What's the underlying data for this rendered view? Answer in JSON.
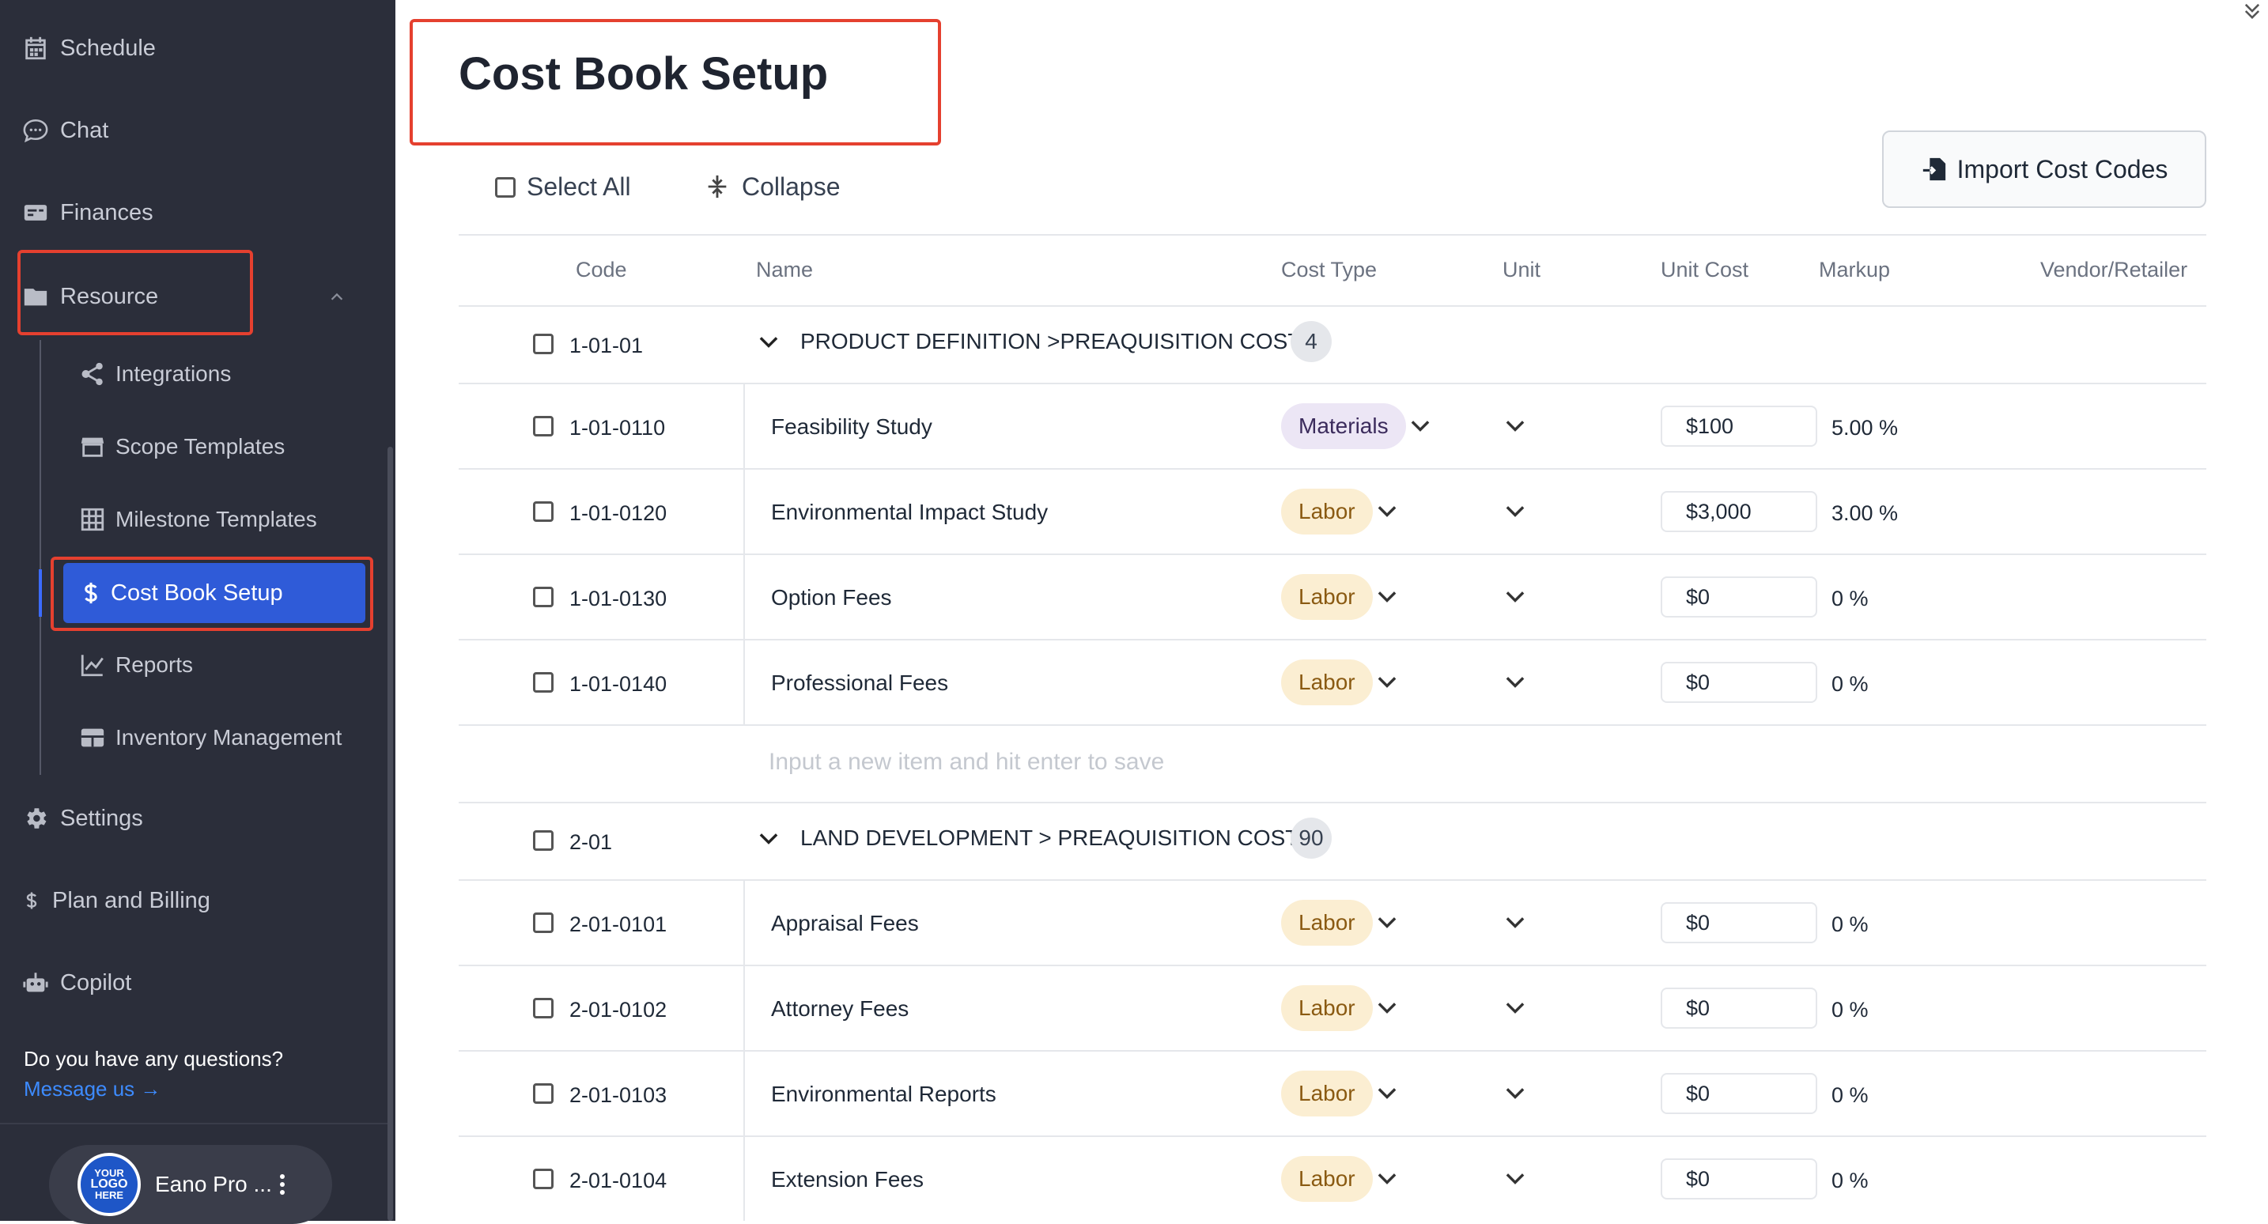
{
  "sidebar": {
    "nav": [
      {
        "label": "Schedule",
        "icon": "calendar-icon"
      },
      {
        "label": "Chat",
        "icon": "chat-icon"
      },
      {
        "label": "Finances",
        "icon": "finances-icon"
      },
      {
        "label": "Resource",
        "icon": "folder-icon"
      }
    ],
    "resource_children": [
      {
        "label": "Integrations",
        "icon": "share-icon"
      },
      {
        "label": "Scope Templates",
        "icon": "store-icon"
      },
      {
        "label": "Milestone Templates",
        "icon": "grid-icon"
      },
      {
        "label": "Cost Book Setup",
        "icon": "dollar-icon",
        "active": true
      },
      {
        "label": "Reports",
        "icon": "chart-line-icon"
      },
      {
        "label": "Inventory Management",
        "icon": "table-icon"
      }
    ],
    "bottom_nav": [
      {
        "label": "Settings",
        "icon": "gear-icon"
      },
      {
        "label": "Plan and Billing",
        "icon": "dollar-icon"
      },
      {
        "label": "Copilot",
        "icon": "robot-icon"
      }
    ],
    "help_question": "Do you have any questions?",
    "help_link": "Message us →",
    "user": {
      "name": "Eano Pro ...",
      "logo_text": [
        "YOUR",
        "LOGO",
        "HERE"
      ]
    }
  },
  "main": {
    "title": "Cost Book Setup",
    "select_all_label": "Select All",
    "collapse_label": "Collapse",
    "import_button_label": "Import Cost Codes",
    "columns": [
      "Code",
      "Name",
      "Cost Type",
      "Unit",
      "Unit Cost",
      "Markup",
      "Vendor/Retailer"
    ],
    "new_item_placeholder": "Input a new item and hit enter to save",
    "groups": [
      {
        "code": "1-01-01",
        "name": "PRODUCT DEFINITION >PREAQUISITION COSTS",
        "count": "4",
        "items": [
          {
            "code": "1-01-0110",
            "name": "Feasibility Study",
            "cost_type": "Materials",
            "unit_cost": "$100",
            "markup": "5.00 %"
          },
          {
            "code": "1-01-0120",
            "name": "Environmental Impact Study",
            "cost_type": "Labor",
            "unit_cost": "$3,000",
            "markup": "3.00 %"
          },
          {
            "code": "1-01-0130",
            "name": "Option Fees",
            "cost_type": "Labor",
            "unit_cost": "$0",
            "markup": "0 %"
          },
          {
            "code": "1-01-0140",
            "name": "Professional Fees",
            "cost_type": "Labor",
            "unit_cost": "$0",
            "markup": "0 %"
          }
        ]
      },
      {
        "code": "2-01",
        "name": "LAND DEVELOPMENT > PREAQUISITION COSTS",
        "count": "90",
        "items": [
          {
            "code": "2-01-0101",
            "name": "Appraisal Fees",
            "cost_type": "Labor",
            "unit_cost": "$0",
            "markup": "0 %"
          },
          {
            "code": "2-01-0102",
            "name": "Attorney Fees",
            "cost_type": "Labor",
            "unit_cost": "$0",
            "markup": "0 %"
          },
          {
            "code": "2-01-0103",
            "name": "Environmental Reports",
            "cost_type": "Labor",
            "unit_cost": "$0",
            "markup": "0 %"
          },
          {
            "code": "2-01-0104",
            "name": "Extension Fees",
            "cost_type": "Labor",
            "unit_cost": "$0",
            "markup": "0 %"
          }
        ]
      }
    ]
  },
  "colors": {
    "sidebar_bg": "#2b2e3a",
    "active_bg": "#2f5bd8",
    "highlight_border": "#e5402f",
    "labor_pill": "#fbeed2",
    "materials_pill": "#ece6f5"
  }
}
